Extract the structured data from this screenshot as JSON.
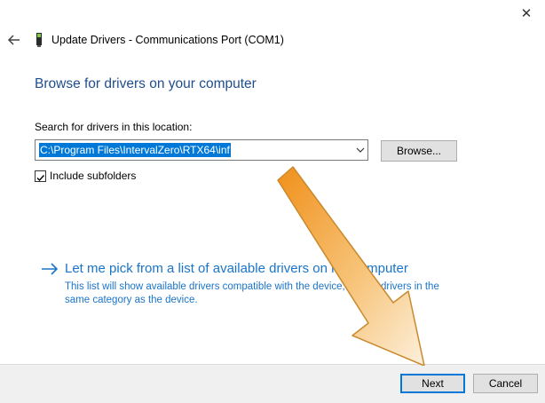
{
  "window": {
    "title": "Update Drivers - Communications Port (COM1)",
    "close_glyph": "✕",
    "back_icon": "arrow-left-icon",
    "device_icon": "device-port-icon"
  },
  "main": {
    "heading": "Browse for drivers on your computer",
    "search_label": "Search for drivers in this location:",
    "path_value": "C:\\Program Files\\IntervalZero\\RTX64\\inf",
    "browse_label": "Browse...",
    "include_subfolders_label": "Include subfolders",
    "include_subfolders_checked": true,
    "pick_link": "Let me pick from a list of available drivers on my computer",
    "pick_description": "This list will show available drivers compatible with the device, and all drivers in the same category as the device."
  },
  "footer": {
    "next_label": "Next",
    "cancel_label": "Cancel"
  },
  "colors": {
    "heading": "#1f4e8c",
    "link": "#1a74c9",
    "selection": "#0078d7",
    "annotation_arrow": "#f0a030"
  }
}
